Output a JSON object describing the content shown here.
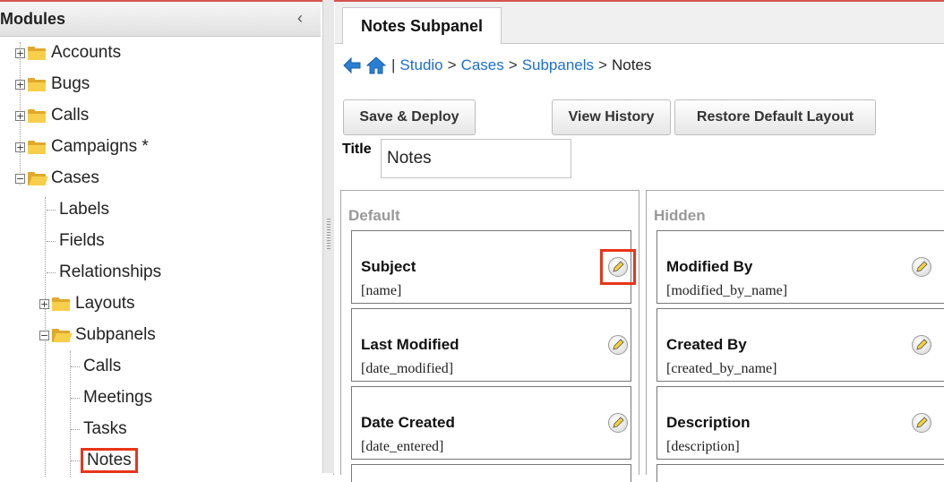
{
  "modules_panel": {
    "title": "Modules",
    "collapse_glyph": "‹",
    "tree": [
      {
        "label": "Accounts",
        "expander": "+"
      },
      {
        "label": "Bugs",
        "expander": "+"
      },
      {
        "label": "Calls",
        "expander": "+"
      },
      {
        "label": "Campaigns *",
        "expander": "+"
      },
      {
        "label": "Cases",
        "expander": "−"
      },
      {
        "label": "Labels"
      },
      {
        "label": "Fields"
      },
      {
        "label": "Relationships"
      },
      {
        "label": "Layouts",
        "expander": "+"
      },
      {
        "label": "Subpanels",
        "expander": "−"
      },
      {
        "label": "Calls"
      },
      {
        "label": "Meetings"
      },
      {
        "label": "Tasks"
      },
      {
        "label": "Notes",
        "highlighted": true
      }
    ]
  },
  "tab": {
    "label": "Notes Subpanel"
  },
  "breadcrumb": {
    "back_icon": "back-arrow-icon",
    "home_icon": "home-icon",
    "separator": "|",
    "items": [
      "Studio",
      "Cases",
      "Subpanels",
      "Notes"
    ],
    "arrow": ">"
  },
  "toolbar": {
    "save_deploy": "Save & Deploy",
    "view_history": "View History",
    "restore_default": "Restore Default Layout"
  },
  "title_field": {
    "label": "Title",
    "value": "Notes"
  },
  "columns": {
    "default": {
      "heading": "Default",
      "fields": [
        {
          "label": "Subject",
          "key": "[name]",
          "highlighted": true
        },
        {
          "label": "Last Modified",
          "key": "[date_modified]"
        },
        {
          "label": "Date Created",
          "key": "[date_entered]"
        }
      ]
    },
    "hidden": {
      "heading": "Hidden",
      "fields": [
        {
          "label": "Modified By",
          "key": "[modified_by_name]"
        },
        {
          "label": "Created By",
          "key": "[created_by_name]"
        },
        {
          "label": "Description",
          "key": "[description]"
        }
      ]
    }
  },
  "colors": {
    "link": "#1a6fd1",
    "highlight": "#e8351a",
    "folder": "#f7cf4a"
  }
}
